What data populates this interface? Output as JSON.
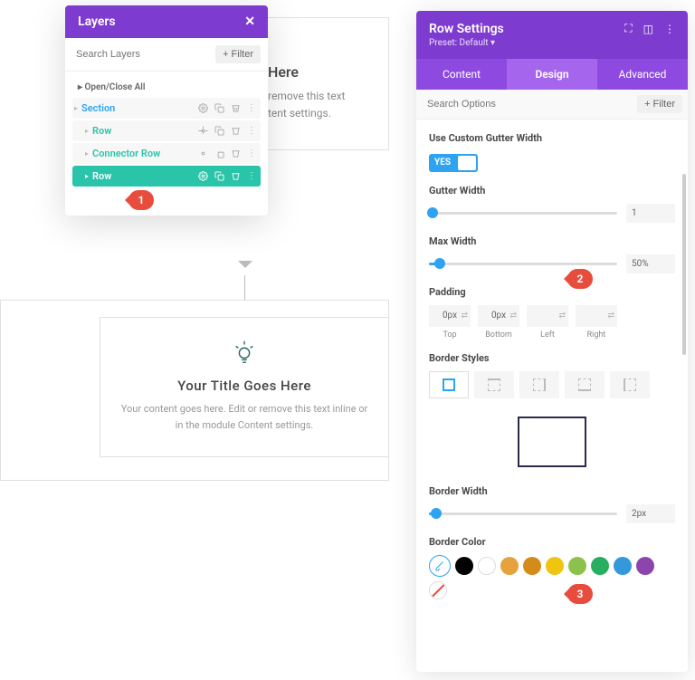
{
  "layers": {
    "title": "Layers",
    "searchPlaceholder": "Search Layers",
    "filterLabel": "+ Filter",
    "openCloseAll": "Open/Close All",
    "items": [
      {
        "label": "Section"
      },
      {
        "label": "Row"
      },
      {
        "label": "Connector Row"
      },
      {
        "label": "Row"
      }
    ]
  },
  "callouts": {
    "one": "1",
    "two": "2",
    "three": "3"
  },
  "canvas": {
    "partialTitle": "Here",
    "partialText1": "remove this text",
    "partialText2": "tent settings.",
    "title": "Your Title Goes Here",
    "content": "Your content goes here. Edit or remove this text inline or in the module Content settings."
  },
  "settings": {
    "title": "Row Settings",
    "preset": "Preset: Default ▾",
    "tabs": {
      "content": "Content",
      "design": "Design",
      "advanced": "Advanced"
    },
    "searchPlaceholder": "Search Options",
    "filterLabel": "+ Filter",
    "labels": {
      "gutterToggle": "Use Custom Gutter Width",
      "toggleYes": "YES",
      "gutterWidth": "Gutter Width",
      "maxWidth": "Max Width",
      "padding": "Padding",
      "borderStyles": "Border Styles",
      "borderWidth": "Border Width",
      "borderColor": "Border Color"
    },
    "values": {
      "gutterWidth": "1",
      "maxWidth": "50%",
      "padTop": "0px",
      "padBottom": "0px",
      "borderWidth": "2px"
    },
    "padLabels": {
      "top": "Top",
      "bottom": "Bottom",
      "left": "Left",
      "right": "Right"
    },
    "colors": [
      "#000000",
      "#ffffff",
      "#e6a23c",
      "#d38b1a",
      "#f1c40f",
      "#2ecc71",
      "#27ae60",
      "#3498db",
      "#8e44ad",
      "#ff6b9d"
    ]
  }
}
